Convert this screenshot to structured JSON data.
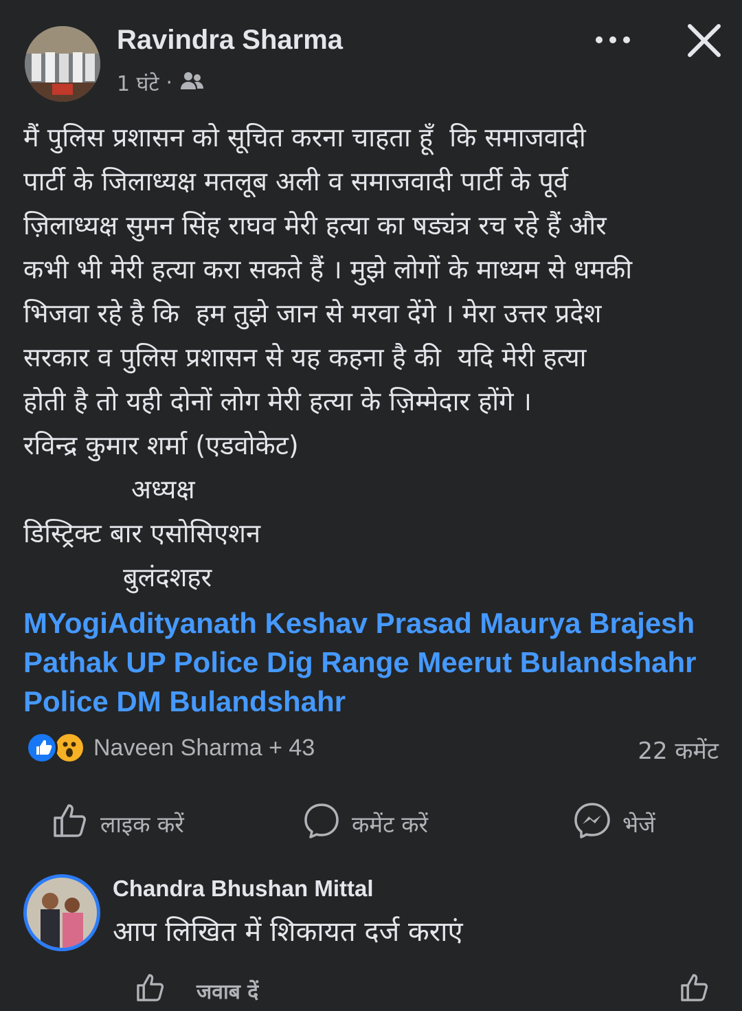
{
  "post": {
    "author": "Ravindra Sharma",
    "time": "1 घंटे",
    "separator": "·",
    "audience_icon": "friends-icon",
    "body_lines": [
      "मैं पुलिस प्रशासन को सूचित करना चाहता हूँ  कि समाजवादी",
      "पार्टी के जिलाध्यक्ष मतलूब अली व समाजवादी पार्टी के पूर्व",
      "ज़िलाध्यक्ष सुमन सिंह राघव मेरी हत्या का षड्यंत्र रच रहे हैं और",
      "कभी भी मेरी हत्या करा सकते हैं । मुझे लोगों के माध्यम से धमकी",
      "भिजवा रहे है कि  हम तुझे जान से मरवा देंगे । मेरा उत्तर प्रदेश",
      "सरकार व पुलिस प्रशासन से यह कहना है की  यदि मेरी हत्या",
      "होती है तो यही दोनों लोग मेरी हत्या के ज़िम्मेदार होंगे ।",
      "रविन्द्र कुमार शर्मा (एडवोकेट)",
      "             अध्यक्ष",
      "डिस्ट्रिक्ट बार एसोसिएशन",
      "            बुलंदशहर"
    ],
    "tags_lines": [
      "MYogiAdityanath Keshav Prasad Maurya Brajesh",
      "Pathak UP Police  Dig Range Meerut Bulandshahr",
      "Police DM Bulandshahr"
    ],
    "tag_color": "#4599ff"
  },
  "reactions": {
    "names": "Naveen Sharma + 43",
    "comment_count": "22 कमेंट"
  },
  "actions": {
    "like": "लाइक करें",
    "comment": "कमेंट करें",
    "send": "भेजें"
  },
  "comment": {
    "author": "Chandra Bhushan Mittal",
    "text": "आप लिखित में शिकायत दर्ज कराएं",
    "reply": "जवाब दें"
  }
}
